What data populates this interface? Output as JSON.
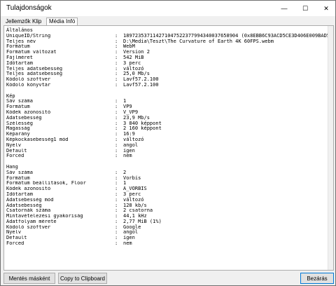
{
  "window": {
    "title": "Tulajdonságok",
    "minimize_glyph": "—",
    "maximize_glyph": "☐",
    "close_glyph": "✕"
  },
  "tabs": [
    {
      "label": "Jellemzők",
      "active": false
    },
    {
      "label": "Klip",
      "active": false
    },
    {
      "label": "Média Infó",
      "active": true
    }
  ],
  "info": [
    {
      "section": "Általános"
    },
    {
      "key": "UniqueID/String",
      "value": "189723537114271047522377994340037658904 (0x8EBB6C93ACD5CE3D406E009BAD558918)"
    },
    {
      "key": "Teljes név",
      "value": "D:\\Media\\Teszt\\The Curvature of Earth 4K 60FPS.webm"
    },
    {
      "key": "Formátum",
      "value": "WebM"
    },
    {
      "key": "Formátum változat",
      "value": "Version 2"
    },
    {
      "key": "Fájlméret",
      "value": "542 MiB"
    },
    {
      "key": "Időtartam",
      "value": "3 perc"
    },
    {
      "key": "Teljes adatsebesség",
      "value": "változó"
    },
    {
      "key": "Teljes adatsebesség",
      "value": "25,0 Mb/s"
    },
    {
      "key": "Kódoló szoftver",
      "value": "Lavf57.2.100"
    },
    {
      "key": "Kódoló könyvtár",
      "value": "Lavf57.2.100"
    },
    {
      "blank": true
    },
    {
      "section": "Kép"
    },
    {
      "key": "Sáv száma",
      "value": "1"
    },
    {
      "key": "Formátum",
      "value": "VP9"
    },
    {
      "key": "Kódek azonosító",
      "value": "V_VP9"
    },
    {
      "key": "Adatsebesség",
      "value": "23,9 Mb/s"
    },
    {
      "key": "Szélesség",
      "value": "3 840 képpont"
    },
    {
      "key": "Magasság",
      "value": "2 160 képpont"
    },
    {
      "key": "Képarány",
      "value": "16:9"
    },
    {
      "key": "Képkockasebesség1 mód",
      "value": "változó"
    },
    {
      "key": "Nyelv",
      "value": "angol"
    },
    {
      "key": "Default",
      "value": "igen"
    },
    {
      "key": "Forced",
      "value": "nem"
    },
    {
      "blank": true
    },
    {
      "section": "Hang"
    },
    {
      "key": "Sáv száma",
      "value": "2"
    },
    {
      "key": "Formátum",
      "value": "Vorbis"
    },
    {
      "key": "Formátum beállítások, Floor",
      "value": "1"
    },
    {
      "key": "Kódek azonosító",
      "value": "A_VORBIS"
    },
    {
      "key": "Időtartam",
      "value": "3 perc"
    },
    {
      "key": "Adatsebesség mód",
      "value": "változó"
    },
    {
      "key": "Adatsebesség",
      "value": "128 kb/s"
    },
    {
      "key": "Csatornák száma",
      "value": "2 csatorna"
    },
    {
      "key": "Mintavételezési gyakoriság",
      "value": "44,1 kHz"
    },
    {
      "key": "Adatfolyam mérete",
      "value": "2,77 MiB (1%)"
    },
    {
      "key": "Kódoló szoftver",
      "value": "Google"
    },
    {
      "key": "Nyelv",
      "value": "angol"
    },
    {
      "key": "Default",
      "value": "igen"
    },
    {
      "key": "Forced",
      "value": "nem"
    }
  ],
  "buttons": {
    "save": "Mentés másként",
    "clipboard": "Copy to Clipboard",
    "close": "Bezárás"
  }
}
